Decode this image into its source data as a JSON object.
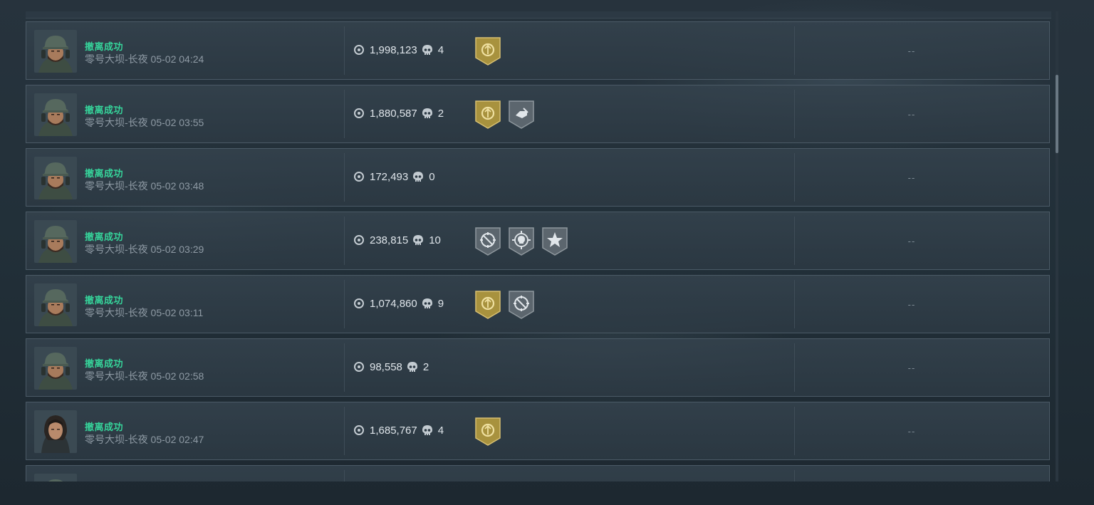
{
  "records": [
    {
      "status": "撤离成功",
      "map_time": "零号大坝-长夜 05-02 04:24",
      "value": "1,998,123",
      "kills": "4",
      "badges": [
        "gold-coin"
      ],
      "extra": "--",
      "avatar": "male"
    },
    {
      "status": "撤离成功",
      "map_time": "零号大坝-长夜 05-02 03:55",
      "value": "1,880,587",
      "kills": "2",
      "badges": [
        "gold-coin",
        "grey-hand"
      ],
      "extra": "--",
      "avatar": "male"
    },
    {
      "status": "撤离成功",
      "map_time": "零号大坝-长夜 05-02 03:48",
      "value": "172,493",
      "kills": "0",
      "badges": [],
      "extra": "--",
      "avatar": "male"
    },
    {
      "status": "撤离成功",
      "map_time": "零号大坝-长夜 05-02 03:29",
      "value": "238,815",
      "kills": "10",
      "badges": [
        "grey-crosshair",
        "grey-skull-target",
        "grey-star"
      ],
      "extra": "--",
      "avatar": "male"
    },
    {
      "status": "撤离成功",
      "map_time": "零号大坝-长夜 05-02 03:11",
      "value": "1,074,860",
      "kills": "9",
      "badges": [
        "gold-coin",
        "grey-crosshair"
      ],
      "extra": "--",
      "avatar": "male"
    },
    {
      "status": "撤离成功",
      "map_time": "零号大坝-长夜 05-02 02:58",
      "value": "98,558",
      "kills": "2",
      "badges": [],
      "extra": "--",
      "avatar": "male"
    },
    {
      "status": "撤离成功",
      "map_time": "零号大坝-长夜 05-02 02:47",
      "value": "1,685,767",
      "kills": "4",
      "badges": [
        "gold-coin"
      ],
      "extra": "--",
      "avatar": "female"
    }
  ],
  "colors": {
    "status_green": "#36d39a",
    "badge_gold": "#a8923e",
    "badge_grey": "#5c666e"
  },
  "icons": {
    "value": "coin-icon",
    "kills": "skull-icon"
  }
}
